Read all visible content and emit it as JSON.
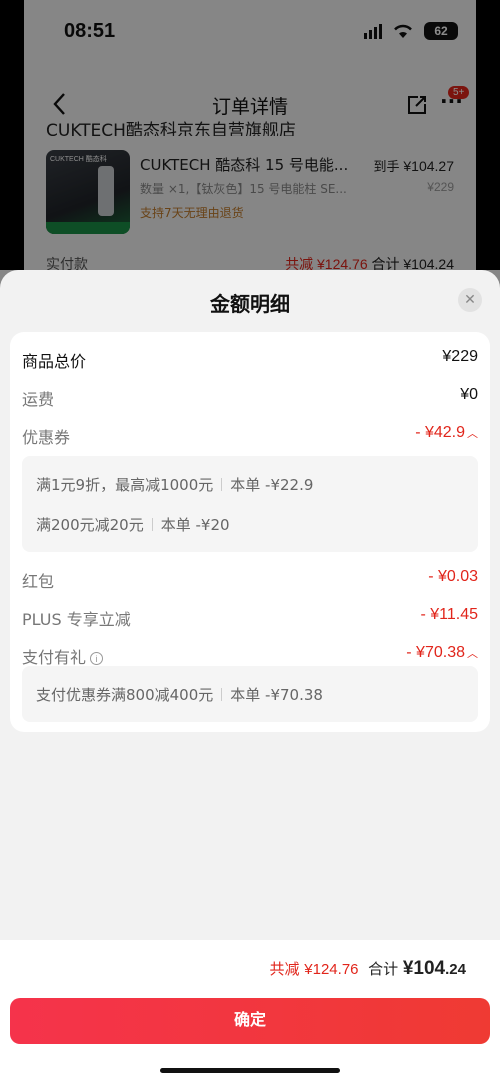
{
  "status_bar": {
    "time": "08:51",
    "battery": "62"
  },
  "nav": {
    "title": "订单详情",
    "badge": "5+"
  },
  "shop": {
    "name_partial": "CUKTECH酷态科京东自营旗舰店"
  },
  "product": {
    "image_brand": "CUKTECH 酷态科",
    "title": "CUKTECH 酷态科 15 号电能...",
    "meta": "数量 ×1,【钛灰色】15 号电能柱 SE...",
    "return_policy": "支持7天无理由退货",
    "price_label": "到手",
    "price": "¥104.27",
    "original_price": "¥229"
  },
  "paid_row": {
    "label": "实付款",
    "discount_label": "共减",
    "discount": "¥124.76",
    "total_label": "合计",
    "total": "¥104.24"
  },
  "sheet": {
    "title": "金额明细",
    "rows": {
      "goods_total": {
        "label": "商品总价",
        "value": "¥229"
      },
      "shipping": {
        "label": "运费",
        "value": "¥0"
      },
      "coupon": {
        "label": "优惠券",
        "value": "- ¥42.9"
      },
      "red_packet": {
        "label": "红包",
        "value": "- ¥0.03"
      },
      "plus": {
        "label": "PLUS 专享立减",
        "value": "- ¥11.45"
      },
      "pay_gift": {
        "label": "支付有礼",
        "value": "- ¥70.38"
      }
    },
    "coupon_details": [
      {
        "rule": "满1元9折，最高减1000元",
        "amount": "本单 -¥22.9"
      },
      {
        "rule": "满200元减20元",
        "amount": "本单 -¥20"
      }
    ],
    "pay_gift_details": [
      {
        "rule": "支付优惠券满800减400元",
        "amount": "本单 -¥70.38"
      }
    ]
  },
  "footer": {
    "discount_label": "共减",
    "discount": "¥124.76",
    "total_label": "合计",
    "total_int": "¥104",
    "total_dec": ".24",
    "confirm": "确定"
  },
  "colors": {
    "accent_red": "#e1251b",
    "button": "#f5334b"
  }
}
